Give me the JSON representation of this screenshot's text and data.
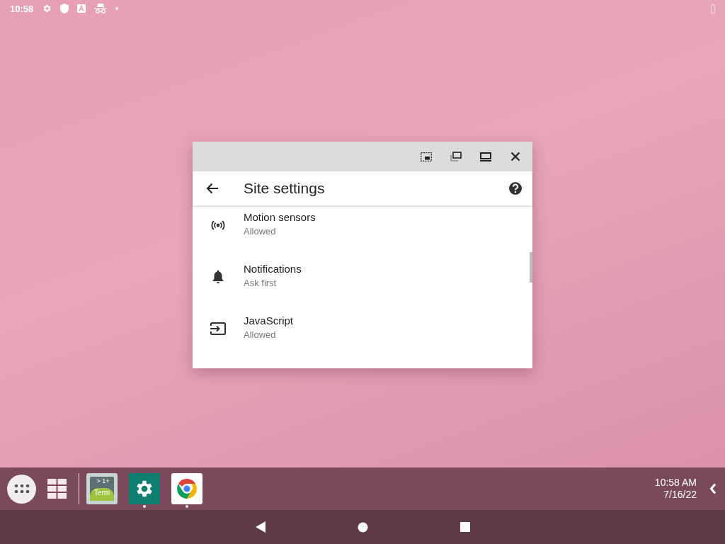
{
  "status_bar": {
    "time": "10:58"
  },
  "window": {
    "title": "Site settings",
    "settings": [
      {
        "kind": "sensors",
        "title": "Motion sensors",
        "status": "Allowed"
      },
      {
        "kind": "bell",
        "title": "Notifications",
        "status": "Ask first"
      },
      {
        "kind": "script",
        "title": "JavaScript",
        "status": "Allowed"
      }
    ]
  },
  "taskbar": {
    "apps": [
      {
        "kind": "terminal",
        "label_top": "> 1+",
        "label_bottom": "Term",
        "running": false
      },
      {
        "kind": "settings",
        "running": true
      },
      {
        "kind": "browser",
        "running": true
      }
    ],
    "time": "10:58 AM",
    "date": "7/16/22"
  }
}
